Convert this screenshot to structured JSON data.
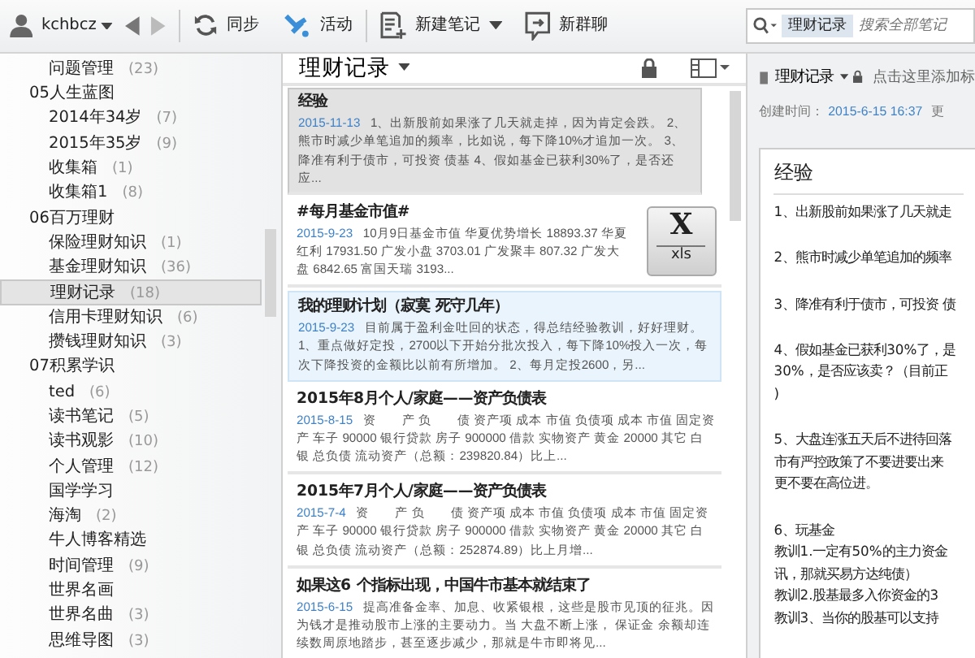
{
  "toolbar": {
    "user": "kchbcz",
    "sync": "同步",
    "activity": "活动",
    "new_note": "新建笔记",
    "new_chat": "新群聊",
    "search": {
      "scope": "理财记录",
      "placeholder": "搜索全部笔记"
    }
  },
  "sidebar": {
    "leading_children": [
      {
        "label": "问题管理",
        "count": "(23)",
        "selected": false
      }
    ],
    "items": [
      {
        "label": "05人生蓝图",
        "children": [
          {
            "label": "2014年34岁",
            "count": "(7)",
            "selected": false
          },
          {
            "label": "2015年35岁",
            "count": "(9)",
            "selected": false
          },
          {
            "label": "收集箱",
            "count": "(1)",
            "selected": false
          },
          {
            "label": "收集箱1",
            "count": "(8)",
            "selected": false
          }
        ]
      },
      {
        "label": "06百万理财",
        "children": [
          {
            "label": "保险理财知识",
            "count": "(1)",
            "selected": false
          },
          {
            "label": "基金理财知识",
            "count": "(36)",
            "selected": false
          },
          {
            "label": "理财记录",
            "count": "(18)",
            "selected": true
          },
          {
            "label": "信用卡理财知识",
            "count": "(6)",
            "selected": false
          },
          {
            "label": "攒钱理财知识",
            "count": "(3)",
            "selected": false
          }
        ]
      },
      {
        "label": "07积累学识",
        "children": [
          {
            "label": "ted",
            "count": "(6)",
            "selected": false
          },
          {
            "label": "读书笔记",
            "count": "(5)",
            "selected": false
          },
          {
            "label": "读书观影",
            "count": "(10)",
            "selected": false
          },
          {
            "label": "个人管理",
            "count": "(12)",
            "selected": false
          },
          {
            "label": "国学学习",
            "selected": false
          },
          {
            "label": "海淘",
            "count": "(2)",
            "selected": false
          },
          {
            "label": "牛人博客精选",
            "selected": false
          },
          {
            "label": "时间管理",
            "count": "(9)",
            "selected": false
          },
          {
            "label": "世界名画",
            "selected": false
          },
          {
            "label": "世界名曲",
            "count": "(3)",
            "selected": false
          },
          {
            "label": "思维导图",
            "count": "(3)",
            "selected": false
          }
        ]
      }
    ]
  },
  "note_list": {
    "title": "理财记录",
    "notes": [
      {
        "title": "经验",
        "date": "2015-11-13",
        "snippet": "1、出新股前如果涨了几天就走掉，因为肯定会跌。 2、熊市时减少单笔追加的频率，比如说，每下降10%才追加一次。 3、降准有利于债市，可投资 债基 4、假如基金已获利30%了，是否还应...",
        "selected": true,
        "hovered": false
      },
      {
        "title": "#每月基金市值#",
        "date": "2015-9-23",
        "snippet": "10月9日基金市值 华夏优势增长 18893.37 华夏红利 17931.50 广发小盘 3703.01 广发聚丰 807.32 广发大盘 6842.65 富国天瑞 3193...",
        "selected": false,
        "hovered": false,
        "attachment": {
          "letter": "X",
          "type": "xls"
        }
      },
      {
        "title": "我的理财计划（寂寞 死守几年）",
        "date": "2015-9-23",
        "snippet": "目前属于盈利金吐回的状态，得总结经验教训，好好理财。 1、重点做好定投，2700以下开始分批次投入，每下降10%投入一次，每次下降投资的金额比以前有所增加。 2、每月定投2600，另...",
        "selected": false,
        "hovered": true
      },
      {
        "title": "2015年8月个人/家庭——资产负债表",
        "date": "2015-8-15",
        "snippet": "资　　产 负　　债 资产项 成本 市值 负债项 成本 市值 固定资产 车子 90000 银行贷款 房子 900000 借款 实物资产 黄金 20000 其它 白银 总负债 流动资产（总额：239820.84）比上...",
        "selected": false,
        "hovered": false
      },
      {
        "title": "2015年7月个人/家庭——资产负债表",
        "date": "2015-7-4",
        "snippet": "资　　产 负　　债 资产项 成本 市值 负债项 成本 市值 固定资产 车子 90000 银行贷款 房子 900000 借款 实物资产 黄金 20000 其它 白银 总负债 流动资产（总额：252874.89）比上月增...",
        "selected": false,
        "hovered": false
      },
      {
        "title": "如果这6 个指标出现，中国牛市基本就结束了",
        "date": "2015-6-15",
        "snippet": "提高准备金率、加息、收紧银根，这些是股市见顶的征兆。因为钱才是推动股市上涨的主要动力。当 大盘不断上涨， 保证金 余额却连续数周原地踏步，甚至逐步减少，那就是牛市即将见...",
        "selected": false,
        "hovered": false
      }
    ]
  },
  "editor": {
    "notebook": "理财记录",
    "tag_hint": "点击这里添加标",
    "created_label": "创建时间：",
    "created": "2015-6-15 16:37",
    "updated_label": "更",
    "title": "经验",
    "paragraphs": [
      [
        "1、出新股前如果涨了几天就走"
      ],
      [
        "2、熊市时减少单笔追加的频率"
      ],
      [
        "3、降准有利于债市，可投资 债"
      ],
      [
        "4、假如基金已获利30%了，是",
        "30%，是否应该卖？（目前正",
        ")"
      ],
      [
        "5、大盘连涨五天后不进待回落",
        "市有严控政策了不要进要出来",
        "更不要在高位进。"
      ],
      [
        "6、玩基金",
        "教训1.一定有50%的主力资金",
        "讯，那就买易方达纯债）",
        "教训2.股基最多入你资金的3",
        "教训3、当你的股基可以支持"
      ]
    ]
  }
}
